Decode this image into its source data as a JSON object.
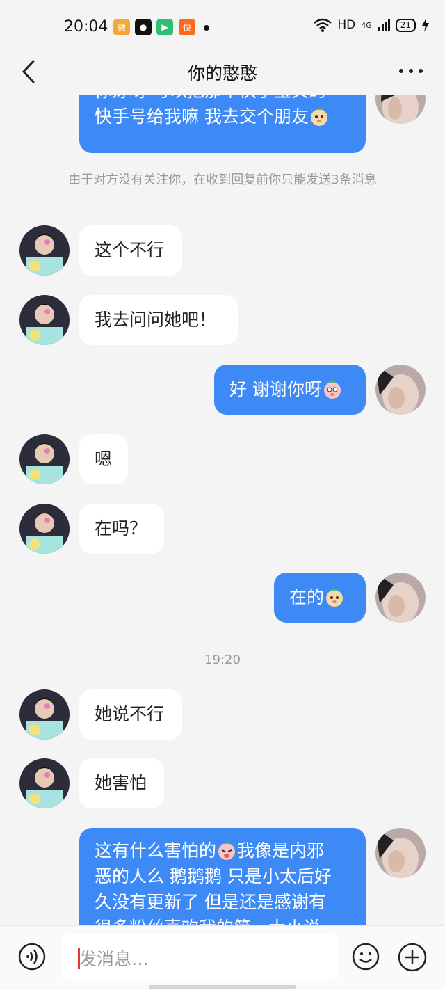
{
  "status": {
    "time": "20:04",
    "network": "HD",
    "signal": "4G",
    "battery": "21"
  },
  "header": {
    "title": "你的憨憨"
  },
  "messages": [
    {
      "from": "me",
      "text_line1": "你好呀 可以把那个快手宝贝的",
      "text_line2": "快手号给我嘛 我去交个朋友"
    },
    {
      "type": "notice",
      "text": "由于对方没有关注你，在收到回复前你只能发送3条消息"
    },
    {
      "from": "other",
      "text": "这个不行"
    },
    {
      "from": "other",
      "text": "我去问问她吧！"
    },
    {
      "from": "me",
      "text": "好 谢谢你呀"
    },
    {
      "from": "other",
      "text": "嗯"
    },
    {
      "from": "other",
      "text": "在吗？"
    },
    {
      "from": "me",
      "text": "在的"
    },
    {
      "type": "time",
      "text": "19:20"
    },
    {
      "from": "other",
      "text": "她说不行"
    },
    {
      "from": "other",
      "text": "她害怕"
    },
    {
      "from": "me",
      "text_line1": "这有什么害怕的",
      "text_line1b": "我像是内邪",
      "text_line2": "恶的人么 鹅鹅鹅 只是小太后好",
      "text_line3": "久没有更新了 但是还是感谢有",
      "text_line4": "很多粉丝喜欢我的简…大小说"
    }
  ],
  "input": {
    "placeholder": "发消息…"
  },
  "colors": {
    "outgoing_bubble": "#3d8af7",
    "incoming_bubble": "#ffffff",
    "background": "#f4f4f4"
  }
}
